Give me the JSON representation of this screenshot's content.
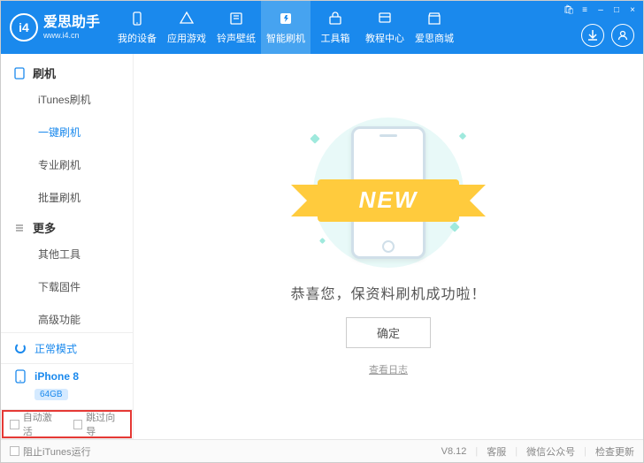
{
  "brand": {
    "logo_text": "i4",
    "title": "爱思助手",
    "subtitle": "www.i4.cn"
  },
  "nav": [
    {
      "icon": "phone-icon",
      "label": "我的设备"
    },
    {
      "icon": "apps-icon",
      "label": "应用游戏"
    },
    {
      "icon": "ringtone-icon",
      "label": "铃声壁纸"
    },
    {
      "icon": "flash-icon",
      "label": "智能刷机",
      "active": true
    },
    {
      "icon": "toolbox-icon",
      "label": "工具箱"
    },
    {
      "icon": "tutorial-icon",
      "label": "教程中心"
    },
    {
      "icon": "store-icon",
      "label": "爱思商城"
    }
  ],
  "title_controls": {
    "basket": "🛍",
    "menu": "≡",
    "min": "–",
    "max": "□",
    "close": "×"
  },
  "right_buttons": {
    "download": "↓",
    "user": "👤"
  },
  "sidebar": {
    "sections": [
      {
        "title": "刷机",
        "icon": "device-icon",
        "items": [
          {
            "label": "iTunes刷机"
          },
          {
            "label": "一键刷机",
            "active": true
          },
          {
            "label": "专业刷机"
          },
          {
            "label": "批量刷机"
          }
        ]
      },
      {
        "title": "更多",
        "icon": "list-icon",
        "items": [
          {
            "label": "其他工具"
          },
          {
            "label": "下载固件"
          },
          {
            "label": "高级功能"
          }
        ]
      }
    ],
    "status": {
      "icon": "spinner-icon",
      "text": "正常模式"
    },
    "device": {
      "icon": "iphone-icon",
      "name": "iPhone 8",
      "badge": "64GB"
    },
    "checkboxes": [
      {
        "label": "自动激活"
      },
      {
        "label": "跳过向导"
      }
    ]
  },
  "main": {
    "ribbon_text": "NEW",
    "success_message": "恭喜您，保资料刷机成功啦！",
    "ok_button": "确定",
    "view_log": "查看日志"
  },
  "footer": {
    "block_itunes": "阻止iTunes运行",
    "version": "V8.12",
    "links": [
      "客服",
      "微信公众号",
      "检查更新"
    ]
  }
}
